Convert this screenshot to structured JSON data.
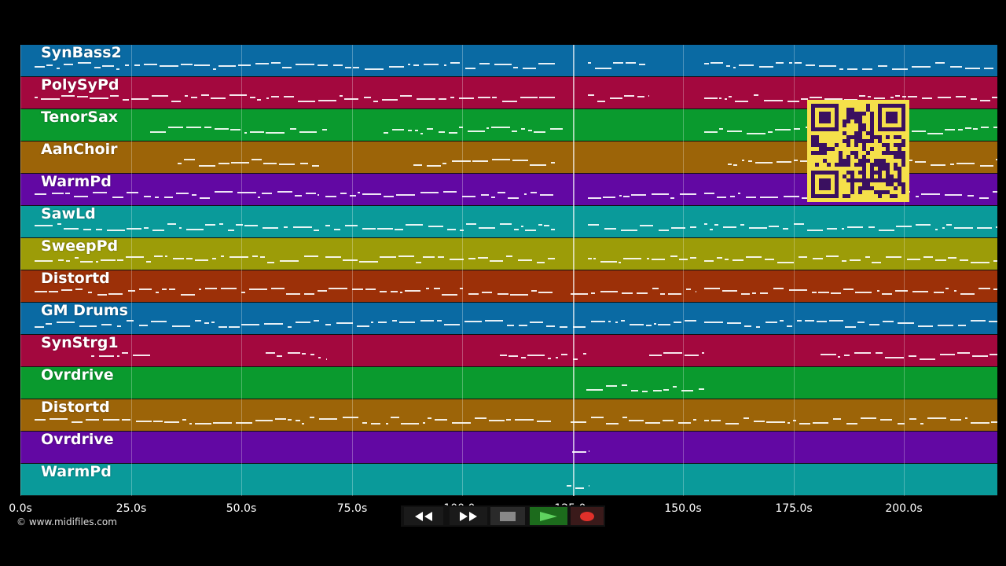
{
  "tracks": [
    {
      "name": "SynBass2",
      "color": "#0a6aa3"
    },
    {
      "name": "PolySyPd",
      "color": "#a3083e"
    },
    {
      "name": "TenorSax",
      "color": "#0a9a2e"
    },
    {
      "name": "AahChoir",
      "color": "#9c6408"
    },
    {
      "name": "WarmPd",
      "color": "#6208a3"
    },
    {
      "name": "SawLd",
      "color": "#0a9a9a"
    },
    {
      "name": "SweepPd",
      "color": "#9c9c08"
    },
    {
      "name": "Distortd",
      "color": "#9c3008"
    },
    {
      "name": "GM Drums",
      "color": "#0a6aa3"
    },
    {
      "name": "SynStrg1",
      "color": "#a3083e"
    },
    {
      "name": "Ovrdrive",
      "color": "#0a9a2e"
    },
    {
      "name": "Distortd",
      "color": "#9c6408"
    },
    {
      "name": "Ovrdrive",
      "color": "#6208a3"
    },
    {
      "name": "WarmPd",
      "color": "#0a9a9a"
    }
  ],
  "timeline": {
    "ticks": [
      "0.0s",
      "25.0s",
      "50.0s",
      "75.0s",
      "100.0s",
      "125.0s",
      "150.0s",
      "175.0s",
      "200.0s"
    ]
  },
  "copyright": "© www.midifiles.com",
  "transport": {
    "rewind_icon": "rewind-icon",
    "forward_icon": "fast-forward-icon",
    "stop_icon": "stop-icon",
    "play_icon": "play-icon",
    "record_icon": "record-icon"
  }
}
